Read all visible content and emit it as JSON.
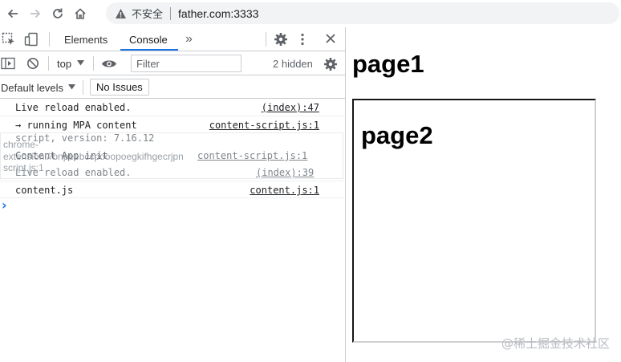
{
  "browser": {
    "nav_icons": [
      "back-arrow-icon",
      "forward-arrow-icon",
      "reload-icon",
      "home-icon"
    ],
    "security_label": "不安全",
    "url": "father.com:3333"
  },
  "devtools": {
    "tabs": [
      {
        "label": "Elements",
        "active": false
      },
      {
        "label": "Console",
        "active": true
      }
    ],
    "more_tabs": "»",
    "context": "top",
    "filter_placeholder": "Filter",
    "hidden_count": "2 hidden",
    "levels_label": "Default levels",
    "issues_label": "No Issues",
    "accent": "#1a73e8",
    "logs": [
      {
        "message": "Live reload enabled.",
        "source": "(index):47"
      },
      {
        "message": "→ running MPA content",
        "source": "content-script.js:1"
      },
      {
        "message": "content.js",
        "source": "content.js:1"
      }
    ],
    "overlap_lines": {
      "version": "script, version: 7.16.12",
      "chrome": "chrome-",
      "app_init": "Content App init",
      "source_overlap": "content-script.js:1",
      "extension_id": "extension://bnpeebccpooopoegkifhgecrjpn",
      "script_ref": "script.js:1",
      "live_reload": "Live reload enabled.",
      "live_reload_source": "(index):39"
    },
    "prompt": "›"
  },
  "page": {
    "heading1": "page1",
    "heading2": "page2",
    "watermark": "@稀土掘金技术社区"
  }
}
